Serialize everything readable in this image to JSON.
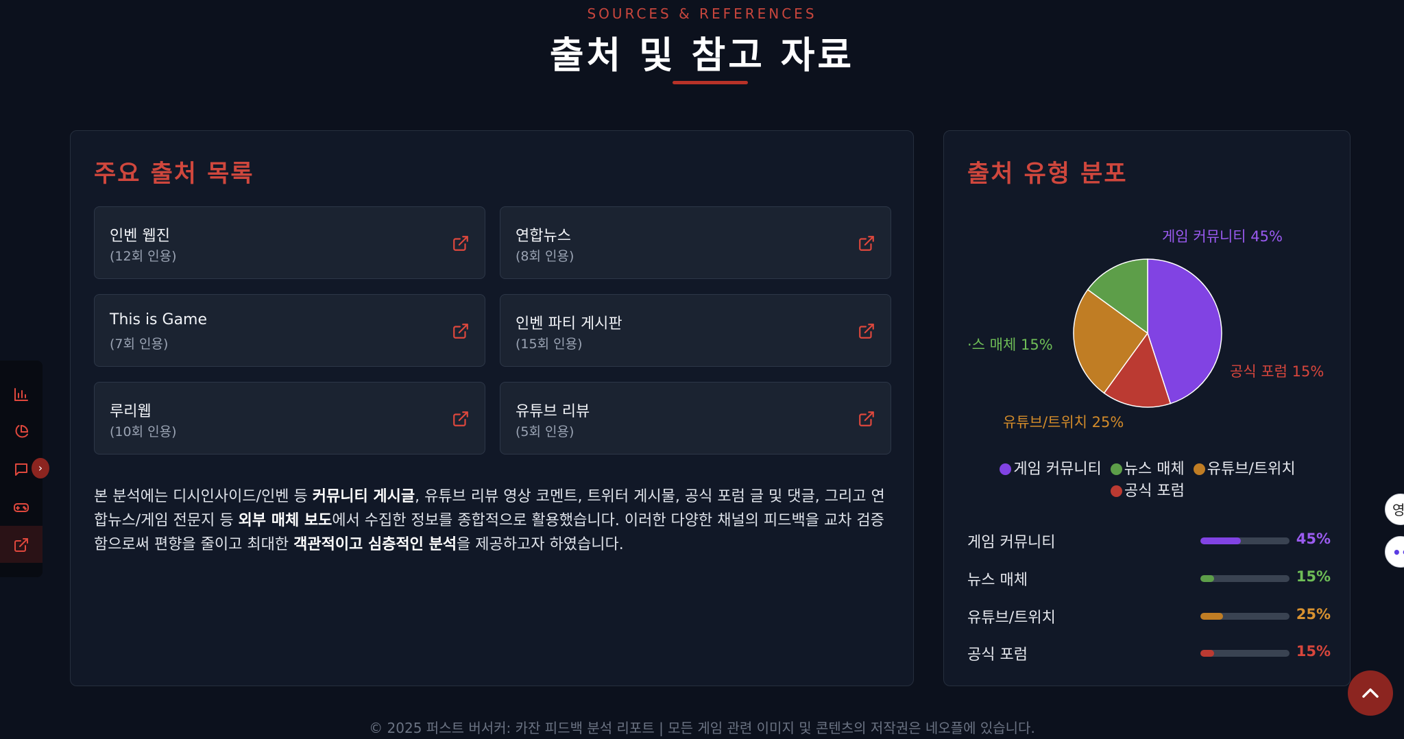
{
  "header": {
    "eyebrow": "SOURCES & REFERENCES",
    "title": "출처 및 참고 자료"
  },
  "sources_card": {
    "heading": "주요 출처 목록",
    "items": [
      {
        "name": "인벤 웹진",
        "count": "(12회 인용)"
      },
      {
        "name": "연합뉴스",
        "count": "(8회 인용)"
      },
      {
        "name": "This is Game",
        "count": "(7회 인용)"
      },
      {
        "name": "인벤 파티 게시판",
        "count": "(15회 인용)"
      },
      {
        "name": "루리웹",
        "count": "(10회 인용)"
      },
      {
        "name": "유튜브 리뷰",
        "count": "(5회 인용)"
      }
    ],
    "description": {
      "p1": "본 분석에는 디시인사이드/인벤 등 ",
      "b1": "커뮤니티 게시글",
      "p2": ", 유튜브 리뷰 영상 코멘트, 트위터 게시물, 공식 포럼 글 및 댓글, 그리고 연합뉴스/게임 전문지 등 ",
      "b2": "외부 매체 보도",
      "p3": "에서 수집한 정보를 종합적으로 활용했습니다. 이러한 다양한 채널의 피드백을 교차 검증함으로써 편향을 줄이고 최대한 ",
      "b3": "객관적이고 심층적인 분석",
      "p4": "을 제공하고자 하였습니다."
    }
  },
  "distribution_card": {
    "heading": "출처 유형 분포"
  },
  "chart_data": {
    "type": "pie",
    "categories": [
      "게임 커뮤니티",
      "공식 포럼",
      "유튜브/트위치",
      "뉴스 매체"
    ],
    "values": [
      45,
      15,
      25,
      15
    ],
    "colors": [
      "#8143e3",
      "#bb3a32",
      "#c07d24",
      "#5d9e49"
    ],
    "slice_labels": [
      "게임 커뮤니티 45%",
      "공식 포럼 15%",
      "유튜브/트위치 25%",
      "·스 매체 15%"
    ],
    "legend": [
      "게임 커뮤니티",
      "뉴스 매체",
      "유튜브/트위치",
      "공식 포럼"
    ],
    "legend_colors": [
      "#8143e3",
      "#5d9e49",
      "#c07d24",
      "#bb3a32"
    ],
    "legend_position": "bottom"
  },
  "stats": [
    {
      "label": "게임 커뮤니티",
      "value": "45%",
      "fraction": 0.45,
      "color": "#8143e3",
      "text_color": "#9b5cf0"
    },
    {
      "label": "뉴스 매체",
      "value": "15%",
      "fraction": 0.15,
      "color": "#5d9e49",
      "text_color": "#6fbe57"
    },
    {
      "label": "유튜브/트위치",
      "value": "25%",
      "fraction": 0.25,
      "color": "#c07d24",
      "text_color": "#d99230"
    },
    {
      "label": "공식 포럼",
      "value": "15%",
      "fraction": 0.15,
      "color": "#bb3a32",
      "text_color": "#d8463c"
    }
  ],
  "sidebar": {
    "icons": [
      "bar-chart-icon",
      "pie-chart-icon",
      "message-icon",
      "gamepad-icon",
      "external-link-icon"
    ],
    "collapse_glyph": "›"
  },
  "floating": {
    "top_glyph": "영",
    "bottom_glyph": "••"
  },
  "footer": {
    "text": "© 2025 퍼스트 버서커: 카잔 피드백 분석 리포트 | 모든 게임 관련 이미지 및 콘텐츠의 저작권은 네오플에 있습니다."
  }
}
